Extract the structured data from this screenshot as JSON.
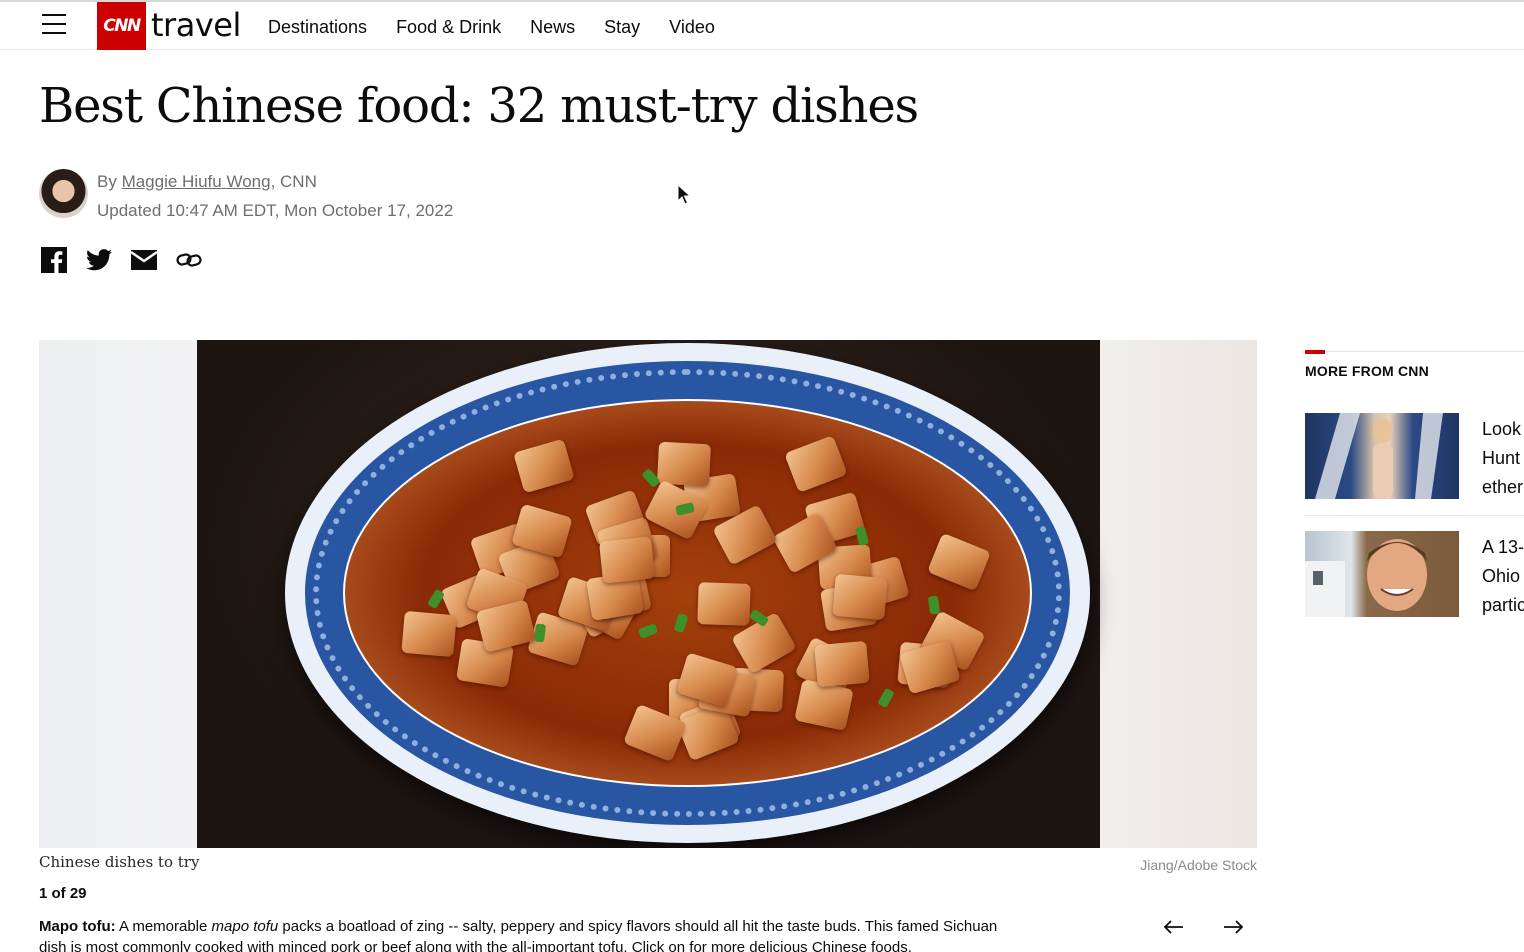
{
  "header": {
    "logo_mark": "CNN",
    "logo_text": "travel",
    "nav": [
      "Destinations",
      "Food & Drink",
      "News",
      "Stay",
      "Video"
    ]
  },
  "article": {
    "title": "Best Chinese food: 32 must-try dishes",
    "byline_prefix": "By ",
    "author": "Maggie Hiufu Wong",
    "byline_suffix": ", CNN",
    "updated": "Updated 10:47 AM EDT, Mon October 17, 2022"
  },
  "share_icons": [
    "facebook-icon",
    "twitter-icon",
    "email-icon",
    "link-icon"
  ],
  "gallery": {
    "caption": "Chinese dishes to try",
    "credit": "Jiang/Adobe Stock",
    "counter": "1 of 29",
    "desc_bold": "Mapo tofu:",
    "desc_1": " A memorable ",
    "desc_italic": "mapo tofu",
    "desc_2": " packs a boatload of zing -- salty, peppery and spicy flavors should all hit the taste buds. This famed Sichuan dish is most commonly cooked with minced pork or beef along with the all-important tofu. Click on for more delicious Chinese foods."
  },
  "sidebar": {
    "title": "MORE FROM CNN",
    "cards": [
      {
        "text": "Look\nHunt\nether"
      },
      {
        "text": "A 13-\nOhio\npartic"
      }
    ]
  },
  "colors": {
    "brand": "#cc0000",
    "text": "#0c0c0c",
    "meta": "#6e6e6e"
  }
}
